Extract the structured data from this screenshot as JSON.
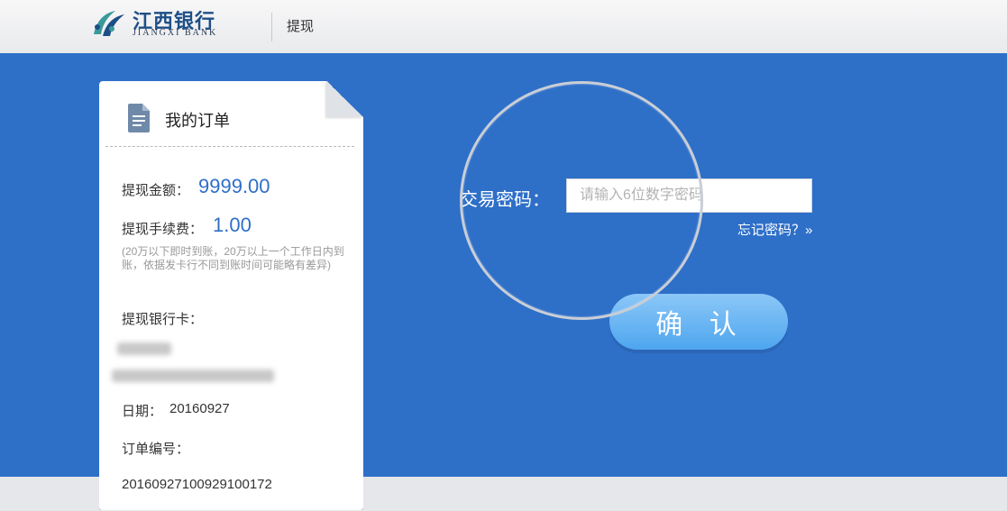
{
  "header": {
    "logo_cn": "江西银行",
    "logo_en": "JIANGXI BANK",
    "title": "提现"
  },
  "order_card": {
    "title": "我的订单",
    "amount_label": "提现金额：",
    "amount_value": "9999.00",
    "fee_label": "提现手续费：",
    "fee_value": "1.00",
    "note": "(20万以下即时到账，20万以上一个工作日内到账，依据发卡行不同到账时间可能略有差异)",
    "card_label": "提现银行卡：",
    "date_label": "日期：",
    "date_value": "20160927",
    "order_no_label": "订单编号：",
    "order_no_value": "20160927100929100172"
  },
  "password": {
    "label": "交易密码：",
    "placeholder": "请输入6位数字密码",
    "forgot_link": "忘记密码？»"
  },
  "confirm_button": "确 认",
  "colors": {
    "band_blue": "#2e6fc8",
    "accent_blue": "#2e6fc8",
    "button_light": "#8cc7f7"
  },
  "icons": {
    "document": "document-icon",
    "logo": "jiangxi-bank-logo"
  }
}
